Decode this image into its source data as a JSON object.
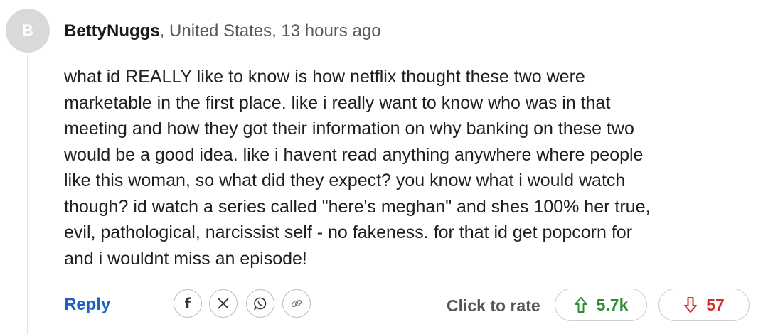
{
  "comment": {
    "avatar_initial": "B",
    "author": "BettyNuggs",
    "meta": ", United States, 13 hours ago",
    "body": "what id REALLY like to know is how netflix thought these two were\nmarketable in the first place. like i really want to know who was in that\nmeeting and how they got their information on why banking on these two\nwould be a good idea. like i havent read anything anywhere where people\nlike this woman, so what did they expect? you know what i would watch\nthough? id watch a series called \"here's meghan\" and shes 100% her true,\nevil, pathological, narcissist self - no fakeness. for that id get popcorn for\nand i wouldnt miss an episode!"
  },
  "actions": {
    "reply_label": "Reply",
    "share_icons": [
      "facebook-icon",
      "x-icon",
      "whatsapp-icon",
      "link-icon"
    ],
    "rate_label": "Click to rate",
    "upvotes": "5.7k",
    "downvotes": "57"
  },
  "colors": {
    "reply": "#1f5fbf",
    "upvote": "#2e8b3a",
    "downvote": "#d62b2b",
    "avatar_bg": "#d9d9d9"
  }
}
